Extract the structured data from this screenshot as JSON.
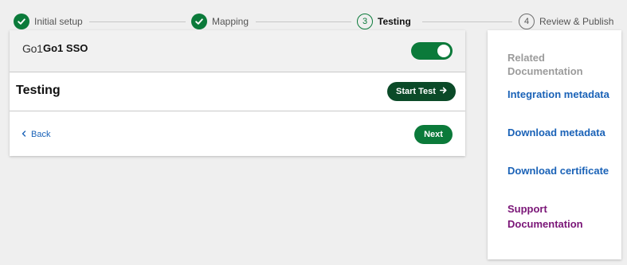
{
  "stepper": {
    "steps": [
      {
        "label": "Initial setup",
        "state": "done",
        "number": ""
      },
      {
        "label": "Mapping",
        "state": "done",
        "number": ""
      },
      {
        "label": "Testing",
        "state": "current",
        "number": "3"
      },
      {
        "label": "Review & Publish",
        "state": "pending",
        "number": "4"
      }
    ]
  },
  "integration": {
    "logo_text": "Go1",
    "name": "Go1 SSO",
    "enabled": true
  },
  "section": {
    "title": "Testing",
    "start_button": "Start Test"
  },
  "nav": {
    "back_label": "Back",
    "next_label": "Next"
  },
  "sidebar": {
    "title": "Related Documentation",
    "links": [
      {
        "label": "Integration metadata"
      },
      {
        "label": "Download metadata"
      },
      {
        "label": "Download certificate"
      },
      {
        "label": "Support Documentation"
      }
    ]
  },
  "colors": {
    "primary_green": "#0b7a3a",
    "dark_green": "#0b4a28",
    "link_blue": "#1a62b7",
    "link_visited": "#7a1577"
  },
  "icons": {
    "step_done": "check-circle-icon",
    "start": "arrow-right-icon",
    "back": "chevron-left-icon"
  }
}
